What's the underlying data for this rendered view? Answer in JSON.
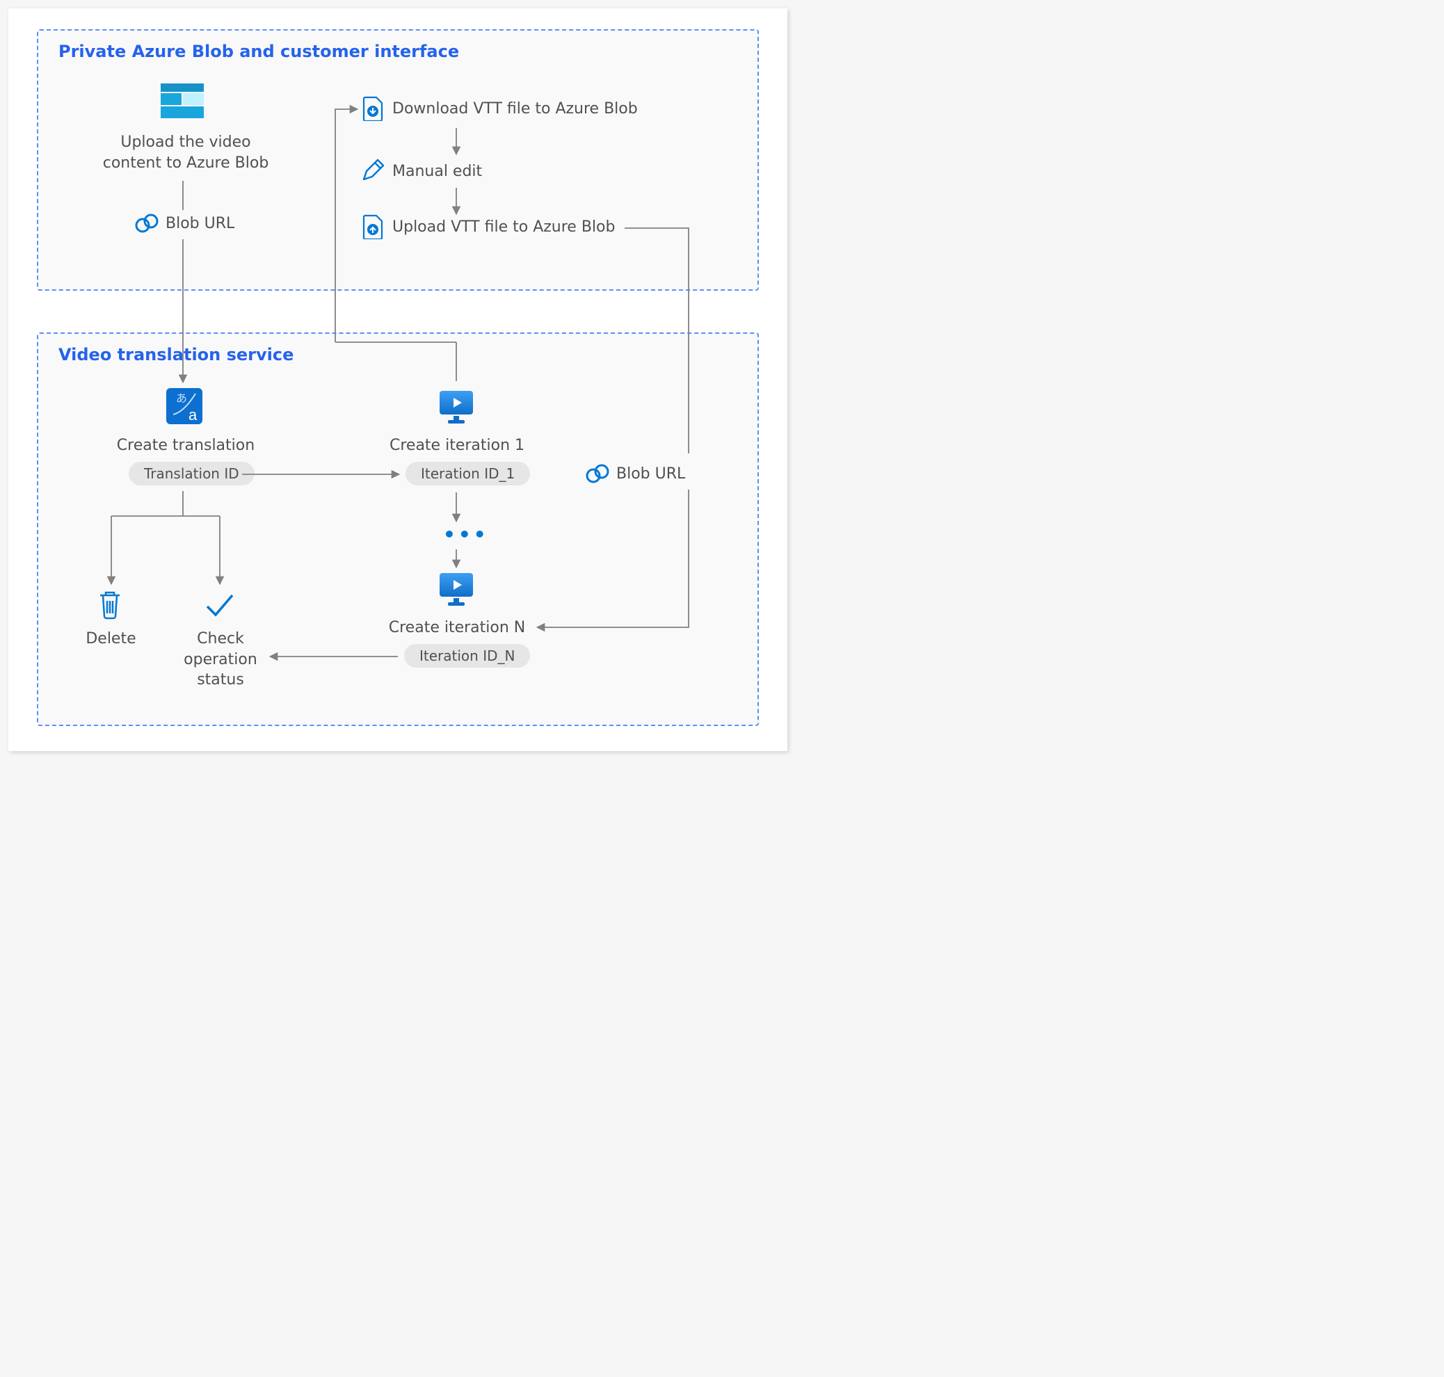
{
  "section_a_title": "Private Azure Blob and customer interface",
  "section_b_title": "Video translation service",
  "upload_video": "Upload the video content to Azure Blob",
  "blob_url_1": "Blob URL",
  "download_vtt": "Download VTT file to Azure Blob",
  "manual_edit": "Manual edit",
  "upload_vtt": "Upload VTT file to Azure Blob",
  "create_translation": "Create translation",
  "translation_id": "Translation ID",
  "create_iter_1": "Create iteration 1",
  "iteration_id_1": "Iteration ID_1",
  "create_iter_n": "Create iteration N",
  "iteration_id_n": "Iteration ID_N",
  "blob_url_2": "Blob URL",
  "delete": "Delete",
  "check_status": "Check operation status",
  "ellipsis": "•••"
}
